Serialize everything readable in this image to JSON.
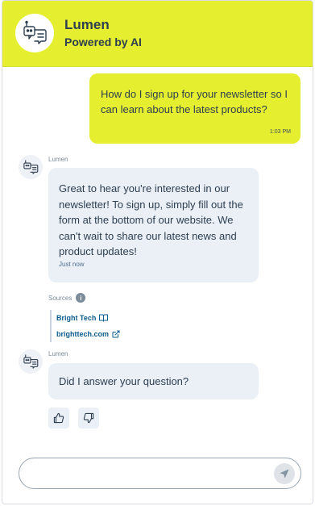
{
  "header": {
    "bot_name": "Lumen",
    "subtitle": "Powered by AI",
    "avatar_icon": "robot-chat-icon"
  },
  "messages": {
    "user": {
      "text": "How do I sign up for your newsletter so I can learn about the latest products?",
      "time": "1:03 PM"
    },
    "bot1": {
      "sender": "Lumen",
      "text": "Great to hear you're interested in our newsletter! To sign up, simply fill out the form at the bottom of our website. We can't wait to share our latest news and product updates!",
      "time": "Just now"
    },
    "sources": {
      "label": "Sources",
      "items": [
        {
          "label": "Bright Tech",
          "icon": "book-icon"
        },
        {
          "label": "brighttech.com",
          "icon": "external-link-icon"
        }
      ]
    },
    "bot2": {
      "sender": "Lumen",
      "text": "Did I answer your question?"
    }
  },
  "feedback": {
    "up_icon": "thumbs-up-icon",
    "down_icon": "thumbs-down-icon"
  },
  "composer": {
    "placeholder": "",
    "value": "",
    "send_icon": "send-icon"
  },
  "colors": {
    "accent": "#e5ef2f",
    "bot_bubble": "#eaf0f6",
    "link": "#0b5c8c",
    "text": "#2d3e50"
  }
}
